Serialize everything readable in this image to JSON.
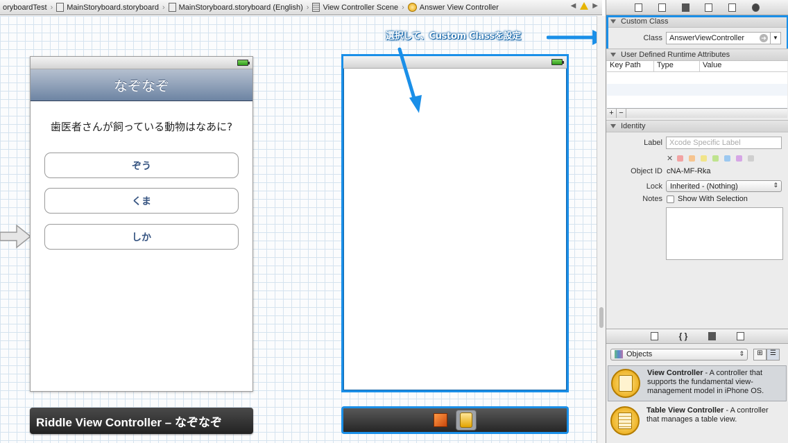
{
  "jumpbar": {
    "crumbs": [
      "oryboardTest",
      "MainStoryboard.storyboard",
      "MainStoryboard.storyboard (English)",
      "View Controller Scene",
      "Answer View Controller"
    ]
  },
  "riddle_scene": {
    "nav_title": "なぞなぞ",
    "question": "歯医者さんが飼っている動物はなあに?",
    "buttons": [
      "ぞう",
      "くま",
      "しか"
    ],
    "scene_label": "Riddle View Controller – なぞなぞ"
  },
  "callout": {
    "text": "選択して、Custom Classを設定"
  },
  "inspector": {
    "custom_class": {
      "header": "Custom Class",
      "class_label": "Class",
      "class_value": "AnswerViewController"
    },
    "runtime_attributes": {
      "header": "User Defined Runtime Attributes",
      "columns": [
        "Key Path",
        "Type",
        "Value"
      ],
      "add": "+",
      "remove": "−"
    },
    "identity": {
      "header": "Identity",
      "label_label": "Label",
      "label_placeholder": "Xcode Specific Label",
      "object_id_label": "Object ID",
      "object_id_value": "cNA-MF-Rka",
      "lock_label": "Lock",
      "lock_value": "Inherited - (Nothing)",
      "notes_label": "Notes",
      "show_with_selection": "Show With Selection",
      "color_swatches": [
        "#f2a3a3",
        "#f6c48f",
        "#f1e48a",
        "#bfe38f",
        "#9cc8f0",
        "#d6a6e6",
        "#cfcfcf"
      ]
    },
    "library": {
      "tabs": [
        "{ }"
      ],
      "filter_value": "Objects",
      "items": [
        {
          "name": "View Controller",
          "desc_line1": " - A controller that",
          "desc_line2": "supports the fundamental view-",
          "desc_line3": "management model in iPhone OS."
        },
        {
          "name": "Table View Controller",
          "desc_line1": " - A controller",
          "desc_line2": "that manages a table view.",
          "desc_line3": ""
        }
      ]
    }
  }
}
